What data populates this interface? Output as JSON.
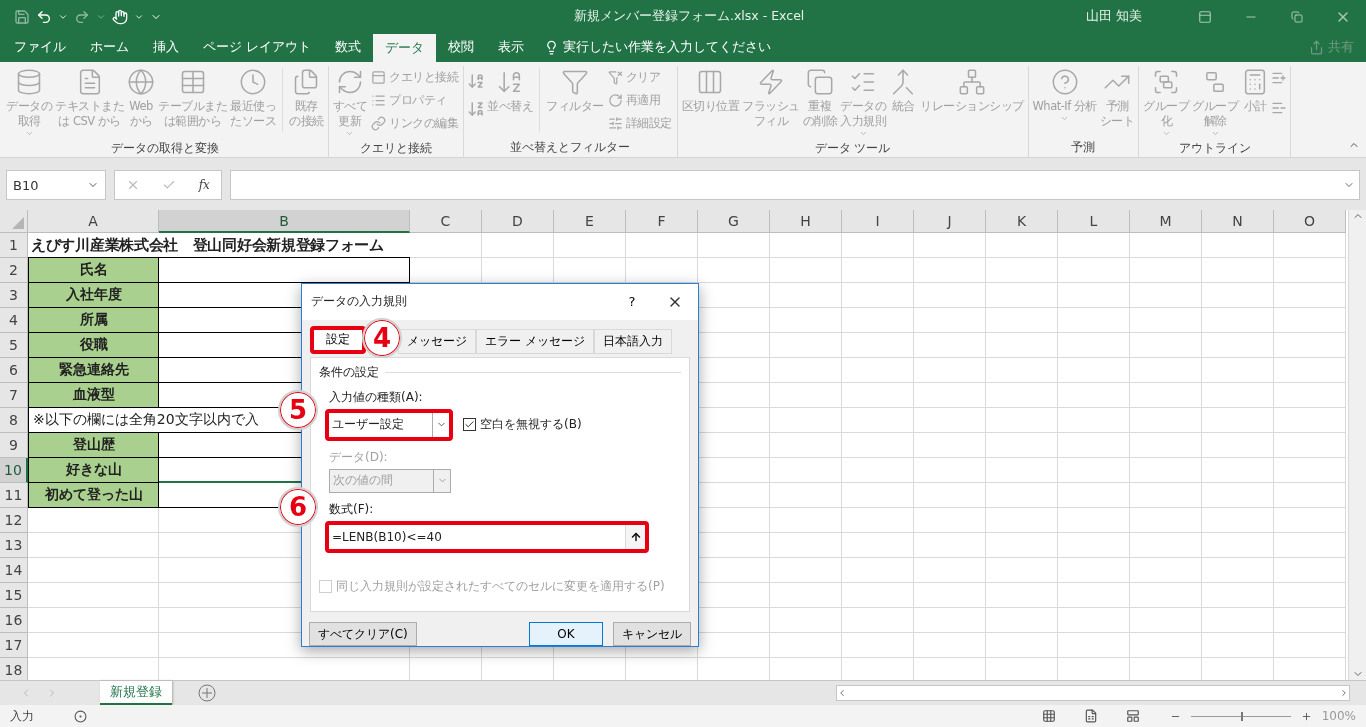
{
  "title_bar": {
    "title": "新規メンバー登録フォーム.xlsx  -  Excel",
    "user": "山田 知美"
  },
  "menu_tabs": [
    {
      "label": "ファイル",
      "selected": false
    },
    {
      "label": "ホーム",
      "selected": false
    },
    {
      "label": "挿入",
      "selected": false
    },
    {
      "label": "ページ レイアウト",
      "selected": false
    },
    {
      "label": "数式",
      "selected": false
    },
    {
      "label": "データ",
      "selected": true
    },
    {
      "label": "校閲",
      "selected": false
    },
    {
      "label": "表示",
      "selected": false
    }
  ],
  "tell_me": "実行したい作業を入力してください",
  "share": "共有",
  "ribbon": [
    {
      "label": "データの取得と変換",
      "buttons": [
        {
          "kind": "large",
          "lines": [
            "データの",
            "取得"
          ],
          "dropdown": true
        },
        {
          "kind": "large",
          "lines": [
            "テキストまた",
            "は CSV から"
          ],
          "dropdown": false
        },
        {
          "kind": "large",
          "lines": [
            "Web",
            "から"
          ],
          "dropdown": false
        },
        {
          "kind": "large",
          "lines": [
            "テーブルまた",
            "は範囲から"
          ],
          "dropdown": false
        },
        {
          "kind": "large",
          "lines": [
            "最近使っ",
            "たソース"
          ],
          "dropdown": false
        },
        {
          "kind": "divider"
        },
        {
          "kind": "large",
          "lines": [
            "既存",
            "の接続"
          ],
          "dropdown": false
        }
      ]
    },
    {
      "label": "クエリと接続",
      "buttons": [
        {
          "kind": "large",
          "lines": [
            "すべて",
            "更新"
          ],
          "dropdown": true
        },
        {
          "kind": "small",
          "items": [
            "クエリと接続",
            "プロパティ",
            "リンクの編集"
          ]
        }
      ]
    },
    {
      "label": "並べ替えとフィルター",
      "buttons": [
        {
          "kind": "sort_icons"
        },
        {
          "kind": "large",
          "lines": [
            "並べ替え"
          ],
          "dropdown": false
        },
        {
          "kind": "divider"
        },
        {
          "kind": "large",
          "lines": [
            "フィルター"
          ],
          "dropdown": false
        },
        {
          "kind": "small",
          "items": [
            "クリア",
            "再適用",
            "詳細設定"
          ]
        }
      ]
    },
    {
      "label": "データ ツール",
      "buttons": [
        {
          "kind": "large",
          "lines": [
            "区切り位置"
          ],
          "dropdown": false
        },
        {
          "kind": "large",
          "lines": [
            "フラッシュ",
            "フィル"
          ],
          "dropdown": false
        },
        {
          "kind": "large",
          "lines": [
            "重複",
            "の削除"
          ],
          "dropdown": false
        },
        {
          "kind": "large",
          "lines": [
            "データの",
            "入力規則"
          ],
          "dropdown": true
        },
        {
          "kind": "large",
          "lines": [
            "統合"
          ],
          "dropdown": false
        },
        {
          "kind": "large",
          "lines": [
            "リレーションシップ"
          ],
          "dropdown": false
        }
      ]
    },
    {
      "label": "予測",
      "buttons": [
        {
          "kind": "large",
          "lines": [
            "What-If 分析"
          ],
          "dropdown": true
        },
        {
          "kind": "large",
          "lines": [
            "予測",
            "シート"
          ],
          "dropdown": false
        }
      ]
    },
    {
      "label": "アウトライン",
      "buttons": [
        {
          "kind": "large",
          "lines": [
            "グループ",
            "化"
          ],
          "dropdown": true
        },
        {
          "kind": "large",
          "lines": [
            "グループ",
            "解除"
          ],
          "dropdown": true
        },
        {
          "kind": "large",
          "lines": [
            "小計"
          ],
          "dropdown": false
        },
        {
          "kind": "outline_icons"
        }
      ]
    }
  ],
  "name_box": "B10",
  "fx": "fx",
  "grid": {
    "columns": [
      {
        "label": "A",
        "selected": false
      },
      {
        "label": "B",
        "selected": true
      },
      {
        "label": "C",
        "selected": false
      },
      {
        "label": "D",
        "selected": false
      },
      {
        "label": "E",
        "selected": false
      },
      {
        "label": "F",
        "selected": false
      },
      {
        "label": "G",
        "selected": false
      },
      {
        "label": "H",
        "selected": false
      },
      {
        "label": "I",
        "selected": false
      },
      {
        "label": "J",
        "selected": false
      },
      {
        "label": "K",
        "selected": false
      },
      {
        "label": "L",
        "selected": false
      },
      {
        "label": "M",
        "selected": false
      },
      {
        "label": "N",
        "selected": false
      },
      {
        "label": "O",
        "selected": false
      }
    ],
    "rows": [
      {
        "label": "1",
        "selected": false,
        "kind": "title",
        "text": "えびす川産業株式会社　登山同好会新規登録フォーム"
      },
      {
        "label": "2",
        "selected": false,
        "kind": "field",
        "text": "氏名"
      },
      {
        "label": "3",
        "selected": false,
        "kind": "field",
        "text": "入社年度"
      },
      {
        "label": "4",
        "selected": false,
        "kind": "field",
        "text": "所属"
      },
      {
        "label": "5",
        "selected": false,
        "kind": "field",
        "text": "役職"
      },
      {
        "label": "6",
        "selected": false,
        "kind": "field",
        "text": "緊急連絡先"
      },
      {
        "label": "7",
        "selected": false,
        "kind": "field",
        "text": "血液型"
      },
      {
        "label": "8",
        "selected": false,
        "kind": "note",
        "text": "※以下の欄には全角20文字以内で入"
      },
      {
        "label": "9",
        "selected": false,
        "kind": "field",
        "text": "登山歴"
      },
      {
        "label": "10",
        "selected": true,
        "kind": "field",
        "text": "好きな山"
      },
      {
        "label": "11",
        "selected": false,
        "kind": "field",
        "text": "初めて登った山"
      },
      {
        "label": "12",
        "selected": false,
        "kind": "empty"
      },
      {
        "label": "13",
        "selected": false,
        "kind": "empty"
      },
      {
        "label": "14",
        "selected": false,
        "kind": "empty"
      },
      {
        "label": "15",
        "selected": false,
        "kind": "empty"
      },
      {
        "label": "16",
        "selected": false,
        "kind": "empty"
      },
      {
        "label": "17",
        "selected": false,
        "kind": "empty"
      },
      {
        "label": "18",
        "selected": false,
        "kind": "empty"
      }
    ]
  },
  "sheets": [
    {
      "label": "新規登録",
      "selected": true
    }
  ],
  "status_bar": {
    "mode": "入力",
    "zoom": {
      "level": 0.5,
      "reading": "100%"
    }
  },
  "dialog": {
    "title": "データの入力規則",
    "help": "?",
    "tabs": [
      {
        "label": "設定",
        "selected": true,
        "highlighted": true
      },
      {
        "label": "メッセージ",
        "selected": false,
        "highlighted": false
      },
      {
        "label": "エラー メッセージ",
        "selected": false,
        "highlighted": false
      },
      {
        "label": "日本語入力",
        "selected": false,
        "highlighted": false
      }
    ],
    "section": "条件の設定",
    "type_label": "入力値の種類(A):",
    "type_value": "ユーザー設定",
    "type_highlighted": true,
    "ignore_blank": {
      "label": "空白を無視する(B)",
      "checked": true
    },
    "data_label": "データ(D):",
    "data_value": "次の値の間",
    "data_disabled": true,
    "formula_label": "数式(F):",
    "formula_value": "=LENB(B10)<=40",
    "formula_highlighted": true,
    "apply_all": {
      "label": "同じ入力規則が設定されたすべてのセルに変更を適用する(P)",
      "checked": false,
      "disabled": true
    },
    "buttons": [
      {
        "label": "すべてクリア(C)",
        "kind": "left"
      },
      {
        "label": "OK",
        "kind": "default"
      },
      {
        "label": "キャンセル",
        "kind": "normal"
      }
    ]
  },
  "callouts": [
    {
      "label": "4"
    },
    {
      "label": "5"
    },
    {
      "label": "6"
    }
  ]
}
